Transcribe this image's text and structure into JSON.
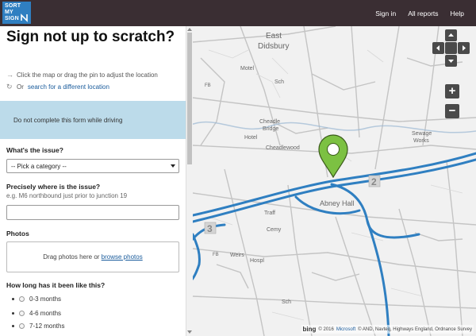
{
  "logo": {
    "lines": [
      "SORT",
      "MY",
      "SIGN"
    ]
  },
  "nav": {
    "signin": "Sign in",
    "all_reports": "All reports",
    "help": "Help"
  },
  "page": {
    "title": "Sign not up to scratch?",
    "instruction_1": "Click the map or drag the pin to adjust the location",
    "instruction_2_prefix": "Or",
    "instruction_2_link": "search for a different location",
    "warning": "Do not complete this form while driving"
  },
  "form": {
    "issue_label": "What's the issue?",
    "issue_selected": "-- Pick a category --",
    "where_label": "Precisely where is the issue?",
    "where_hint": "e.g. M6 northbound just prior to junction 19",
    "where_value": "",
    "photos_label": "Photos",
    "photos_text": "Drag photos here or",
    "photos_link": "browse photos",
    "duration_label": "How long has it been like this?",
    "duration_options": [
      "0-3 months",
      "4-6 months",
      "7-12 months"
    ]
  },
  "map": {
    "labels": {
      "east_didsbury_1": "East",
      "east_didsbury_2": "Didsbury",
      "motel": "Motel",
      "sch_1": "Sch",
      "cheadle_bridge_1": "Cheadle",
      "cheadle_bridge_2": "Bridge",
      "hotel": "Hotel",
      "cheadlewood": "Cheadlewood",
      "sewage_1": "Sewage",
      "sewage_2": "Works",
      "fb_1": "FB",
      "abney_hall": "Abney Hall",
      "traffic": "Traff",
      "cemy": "Cemy",
      "weirs": "Weirs",
      "hospl": "Hospl",
      "fb_2": "FB",
      "sch_2": "Sch",
      "junction_2": "2",
      "junction_3": "3"
    },
    "zoom_in": "+",
    "zoom_out": "−",
    "attribution_prefix": "© 2016",
    "attribution_microsoft": "Microsoft",
    "attribution_rest": "© AND, Navteq, Highways England, Ordnance Survey",
    "bing": "bing"
  },
  "colors": {
    "topbar": "#3a2e33",
    "logo": "#2f7fc1",
    "link": "#1a5c9c",
    "warning_bg": "#bcdbea",
    "road": "#2f7fc1",
    "pin": "#7cc142"
  }
}
